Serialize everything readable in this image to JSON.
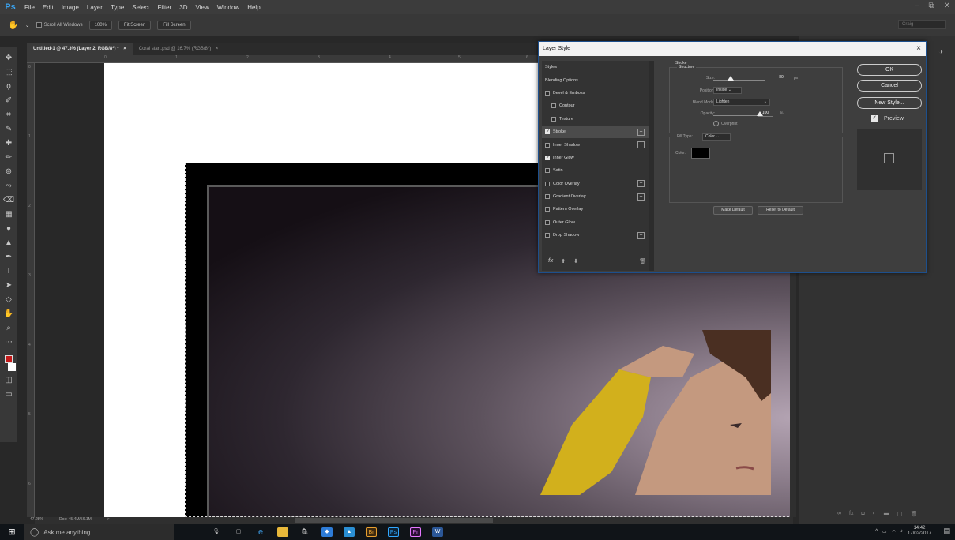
{
  "app": {
    "logo": "Ps",
    "window_user": "Craig"
  },
  "menu": [
    "File",
    "Edit",
    "Image",
    "Layer",
    "Type",
    "Select",
    "Filter",
    "3D",
    "View",
    "Window",
    "Help"
  ],
  "options_bar": {
    "scroll_all_windows": "Scroll All Windows",
    "zoom_100": "100%",
    "fit_screen": "Fit Screen",
    "fill_screen": "Fill Screen"
  },
  "tabs": [
    {
      "label": "Untitled-1 @ 47.3% (Layer 2, RGB/8*) *",
      "close": "×",
      "active": true
    },
    {
      "label": "Coral start.psd @ 16.7% (RGB/8*)",
      "close": "×",
      "active": false
    }
  ],
  "ruler_top": [
    "0",
    "1",
    "2",
    "3",
    "4",
    "5",
    "6"
  ],
  "ruler_left": [
    "0",
    "1",
    "2",
    "3",
    "4",
    "5",
    "6"
  ],
  "status": {
    "zoom": "47.28%",
    "doc": "Doc: 45.4M/56.1M",
    "arrow": ">"
  },
  "dialog": {
    "title": "Layer Style",
    "close": "×",
    "styles": [
      {
        "label": "Styles",
        "type": "header"
      },
      {
        "label": "Blending Options",
        "type": "header"
      },
      {
        "label": "Bevel & Emboss",
        "checked": false
      },
      {
        "label": "Contour",
        "checked": false,
        "indent": true
      },
      {
        "label": "Texture",
        "checked": false,
        "indent": true
      },
      {
        "label": "Stroke",
        "checked": true,
        "plus": "+",
        "selected": true
      },
      {
        "label": "Inner Shadow",
        "checked": false,
        "plus": "+"
      },
      {
        "label": "Inner Glow",
        "checked": true
      },
      {
        "label": "Satin",
        "checked": false
      },
      {
        "label": "Color Overlay",
        "checked": false,
        "plus": "+"
      },
      {
        "label": "Gradient Overlay",
        "checked": false,
        "plus": "+"
      },
      {
        "label": "Pattern Overlay",
        "checked": false
      },
      {
        "label": "Outer Glow",
        "checked": false
      },
      {
        "label": "Drop Shadow",
        "checked": false,
        "plus": "+"
      }
    ],
    "footer_fx": "fx",
    "stroke": {
      "section": "Stroke",
      "structure": "Structure",
      "size_label": "Size:",
      "size_value": "80",
      "size_unit": "px",
      "position_label": "Position:",
      "position_value": "Inside",
      "blend_label": "Blend Mode:",
      "blend_value": "Lighten",
      "opacity_label": "Opacity:",
      "opacity_value": "100",
      "opacity_unit": "%",
      "overprint": "Overprint",
      "fill_type_label": "Fill Type:",
      "fill_type_value": "Color",
      "color_label": "Color:",
      "make_default": "Make Default",
      "reset_default": "Reset to Default"
    },
    "buttons": {
      "ok": "OK",
      "cancel": "Cancel",
      "new_style": "New Style...",
      "preview": "Preview"
    }
  },
  "taskbar": {
    "search_placeholder": "Ask me anything",
    "time": "14:42",
    "date": "17/02/2017",
    "apps": [
      "Br",
      "Ps",
      "Pr",
      "W"
    ]
  },
  "colors": {
    "accent": "#31a8ff",
    "foreground": "#c41a1a",
    "shirt": "#d4b422"
  }
}
